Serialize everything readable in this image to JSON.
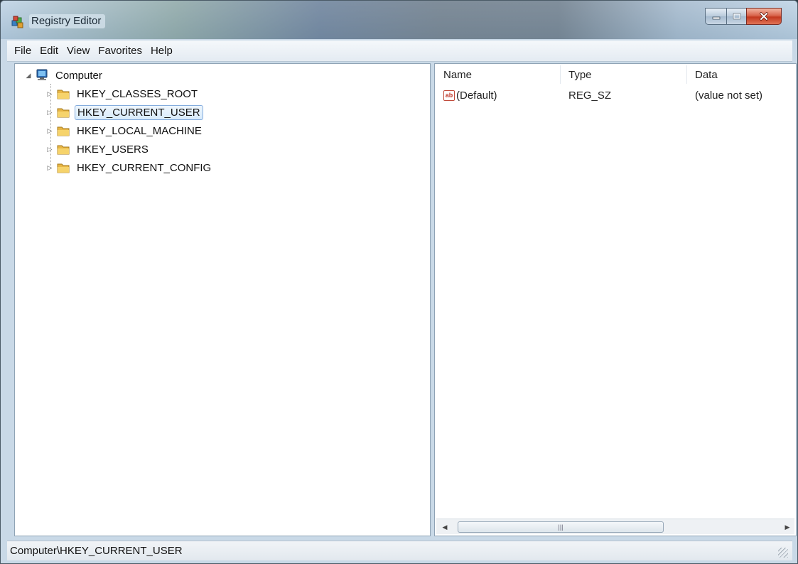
{
  "window": {
    "title": "Registry Editor"
  },
  "menu": {
    "items": [
      "File",
      "Edit",
      "View",
      "Favorites",
      "Help"
    ]
  },
  "tree": {
    "root_label": "Computer",
    "keys": [
      {
        "label": "HKEY_CLASSES_ROOT",
        "selected": false
      },
      {
        "label": "HKEY_CURRENT_USER",
        "selected": true
      },
      {
        "label": "HKEY_LOCAL_MACHINE",
        "selected": false
      },
      {
        "label": "HKEY_USERS",
        "selected": false
      },
      {
        "label": "HKEY_CURRENT_CONFIG",
        "selected": false
      }
    ]
  },
  "list": {
    "columns": [
      "Name",
      "Type",
      "Data"
    ],
    "rows": [
      {
        "name": "(Default)",
        "type": "REG_SZ",
        "data": "(value not set)",
        "icon": "string-value-icon"
      }
    ]
  },
  "status": {
    "path": "Computer\\HKEY_CURRENT_USER"
  },
  "colors": {
    "selection_border": "#84acdd",
    "close_button": "#c3391f"
  }
}
